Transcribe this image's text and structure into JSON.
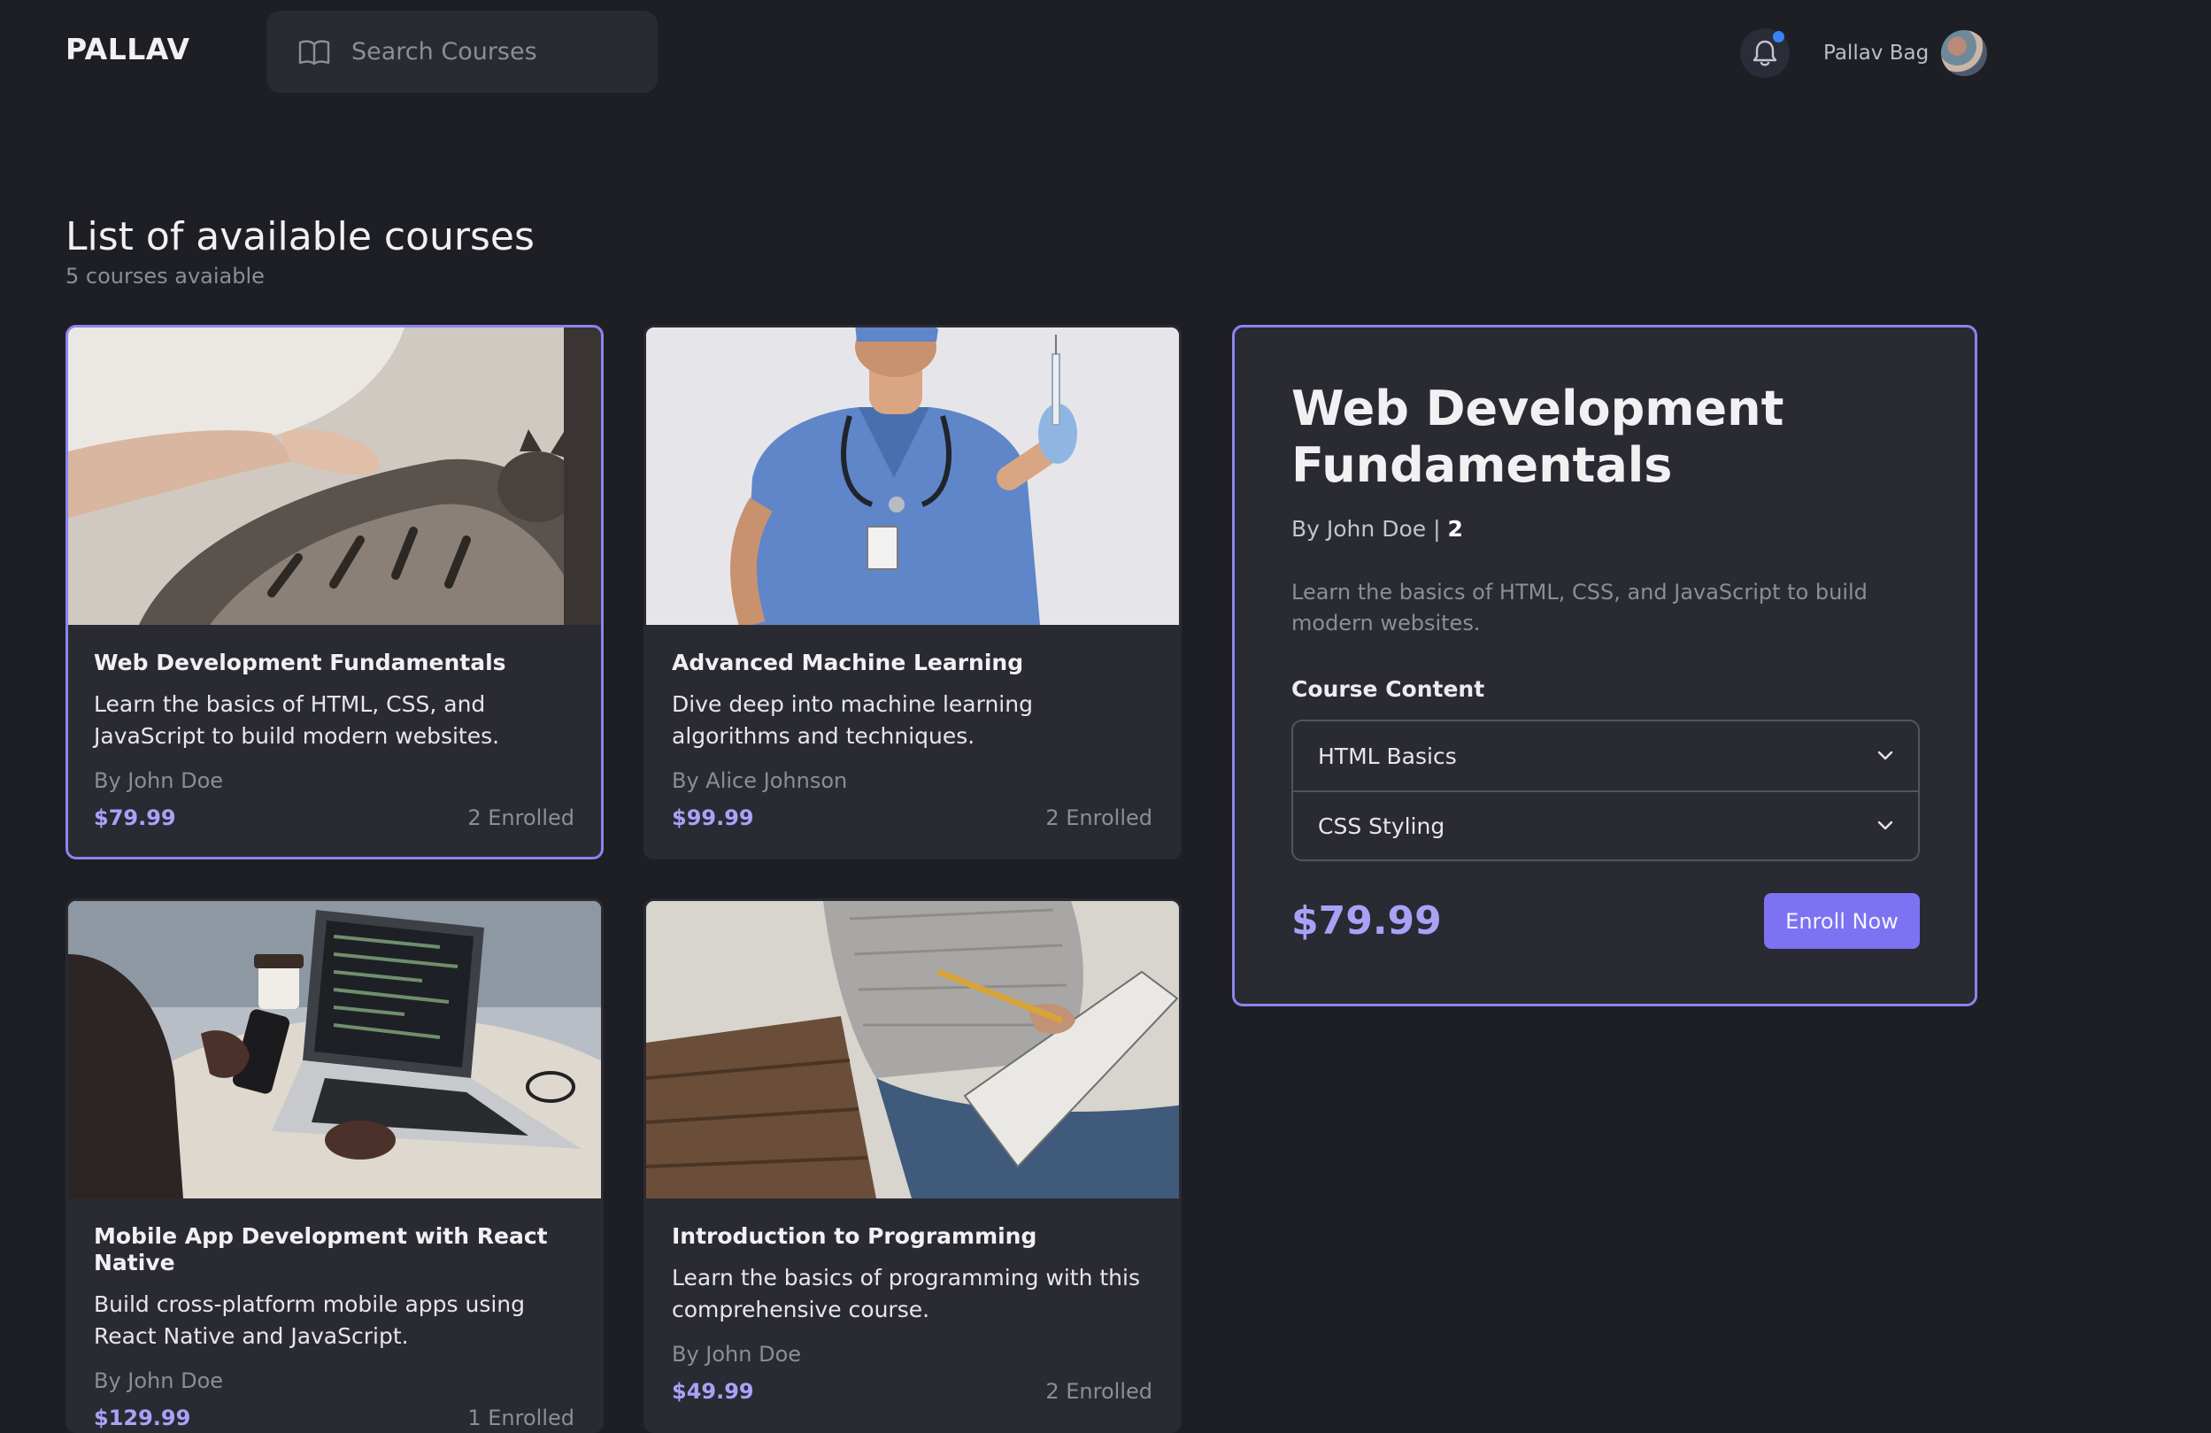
{
  "header": {
    "logo": "PALLAV",
    "search_placeholder": "Search Courses",
    "user_name": "Pallav Bag"
  },
  "page": {
    "title": "List of available courses",
    "subtitle": "5 courses avaiable"
  },
  "courses": [
    {
      "title": "Web Development Fundamentals",
      "description": "Learn the basics of HTML, CSS, and JavaScript to build modern websites.",
      "author": "By John Doe",
      "price": "$79.99",
      "enrolled": "2 Enrolled",
      "selected": true
    },
    {
      "title": "Advanced Machine Learning",
      "description": "Dive deep into machine learning algorithms and techniques.",
      "author": "By Alice Johnson",
      "price": "$99.99",
      "enrolled": "2 Enrolled",
      "selected": false
    },
    {
      "title": "Mobile App Development with React Native",
      "description": "Build cross-platform mobile apps using React Native and JavaScript.",
      "author": "By John Doe",
      "price": "$129.99",
      "enrolled": "1 Enrolled",
      "selected": false
    },
    {
      "title": "Introduction to Programming",
      "description": "Learn the basics of programming with this comprehensive course.",
      "author": "By John Doe",
      "price": "$49.99",
      "enrolled": "2 Enrolled",
      "selected": false
    }
  ],
  "detail": {
    "title": "Web Development Fundamentals",
    "author": "By John Doe",
    "separator": "|",
    "count": "2",
    "description": "Learn the basics of HTML, CSS, and JavaScript to build modern websites.",
    "content_label": "Course Content",
    "content_items": [
      "HTML Basics",
      "CSS Styling"
    ],
    "price": "$79.99",
    "enroll_label": "Enroll Now"
  },
  "colors": {
    "background": "#1e1e25",
    "card": "#2a2a33",
    "accent": "#8b84f0",
    "price": "#a8a2f7",
    "button": "#7c72f2",
    "notification_dot": "#3b82f6"
  },
  "icons": [
    "book-open-icon",
    "bell-icon",
    "chevron-down-icon"
  ]
}
